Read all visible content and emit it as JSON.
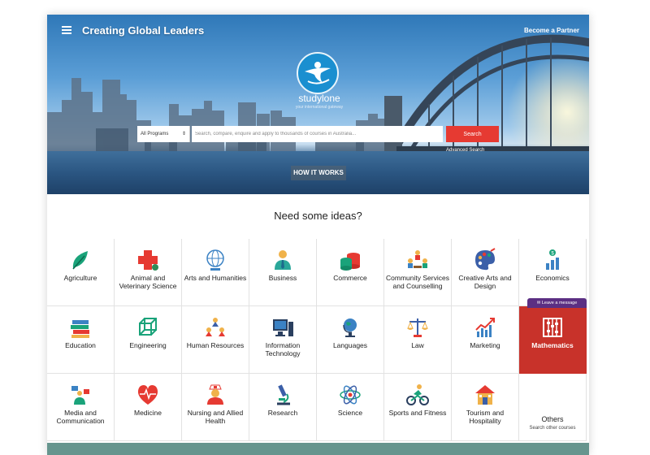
{
  "header": {
    "brand": "Creating Global Leaders",
    "become_link": "Become a Partner"
  },
  "hero": {
    "logo_word": "studylone",
    "logo_tagline": "your international gateway",
    "program_select": "All Programs",
    "search_placeholder": "Search, compare, enquire and apply to thousands of courses in Australia...",
    "search_button": "Search",
    "advanced_search": "Advanced Search",
    "how_it_works": "HOW IT WORKS"
  },
  "ideas": {
    "title": "Need some ideas?",
    "active_color": "#c8322a",
    "categories": [
      {
        "label": "Agriculture",
        "icon": "leaf-icon"
      },
      {
        "label": "Animal and\nVeterinary Science",
        "icon": "medical-cross-icon"
      },
      {
        "label": "Arts and Humanities",
        "icon": "globe-icon"
      },
      {
        "label": "Business",
        "icon": "businessman-icon"
      },
      {
        "label": "Commerce",
        "icon": "coins-icon"
      },
      {
        "label": "Community Services\nand Counselling",
        "icon": "meeting-icon"
      },
      {
        "label": "Creative Arts and\nDesign",
        "icon": "palette-icon"
      },
      {
        "label": "Economics",
        "icon": "economics-chart-icon"
      },
      {
        "label": "Education",
        "icon": "books-icon"
      },
      {
        "label": "Engineering",
        "icon": "cube-icon"
      },
      {
        "label": "Human Resources",
        "icon": "org-chart-icon"
      },
      {
        "label": "Information\nTechnology",
        "icon": "computer-icon"
      },
      {
        "label": "Languages",
        "icon": "desk-globe-icon"
      },
      {
        "label": "Law",
        "icon": "scales-icon"
      },
      {
        "label": "Marketing",
        "icon": "trend-chart-icon"
      },
      {
        "label": "Mathematics",
        "icon": "abacus-icon"
      },
      {
        "label": "Media and\nCommunication",
        "icon": "media-icon"
      },
      {
        "label": "Medicine",
        "icon": "heart-pulse-icon"
      },
      {
        "label": "Nursing and Allied\nHealth",
        "icon": "nurse-icon"
      },
      {
        "label": "Research",
        "icon": "microscope-icon"
      },
      {
        "label": "Science",
        "icon": "atom-icon"
      },
      {
        "label": "Sports and Fitness",
        "icon": "cyclist-icon"
      },
      {
        "label": "Tourism and\nHospitality",
        "icon": "house-icon"
      },
      {
        "label": "Others",
        "icon": ""
      }
    ],
    "others_sub": "Search other courses"
  },
  "chat": {
    "leave_message": "Leave a message"
  }
}
